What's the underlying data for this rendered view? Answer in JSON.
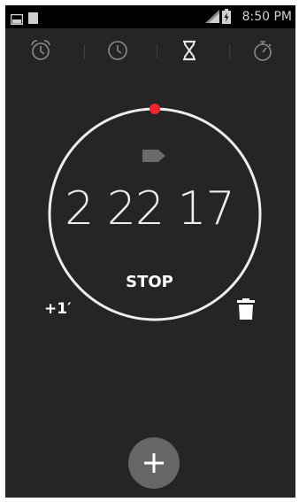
{
  "status_bar": {
    "time": "8:50 PM",
    "icons": [
      "screenshot-icon",
      "sd-card-icon",
      "signal-icon",
      "battery-icon"
    ]
  },
  "tabs": [
    {
      "name": "alarm",
      "icon": "alarm-clock-icon",
      "selected": false
    },
    {
      "name": "clock",
      "icon": "clock-icon",
      "selected": false
    },
    {
      "name": "timer",
      "icon": "hourglass-icon",
      "selected": true
    },
    {
      "name": "stopwatch",
      "icon": "stopwatch-icon",
      "selected": false
    }
  ],
  "timer": {
    "display": "2 22 17",
    "stop_label": "STOP",
    "add_minute_label": "+1′",
    "progress_marker_color": "#f0262b"
  },
  "fab": {
    "icon": "plus-icon",
    "label": "+"
  },
  "colors": {
    "background": "#252525",
    "status_bar": "#000000",
    "ring": "#eeeeee",
    "accent": "#f0262b",
    "fab": "#676767"
  }
}
